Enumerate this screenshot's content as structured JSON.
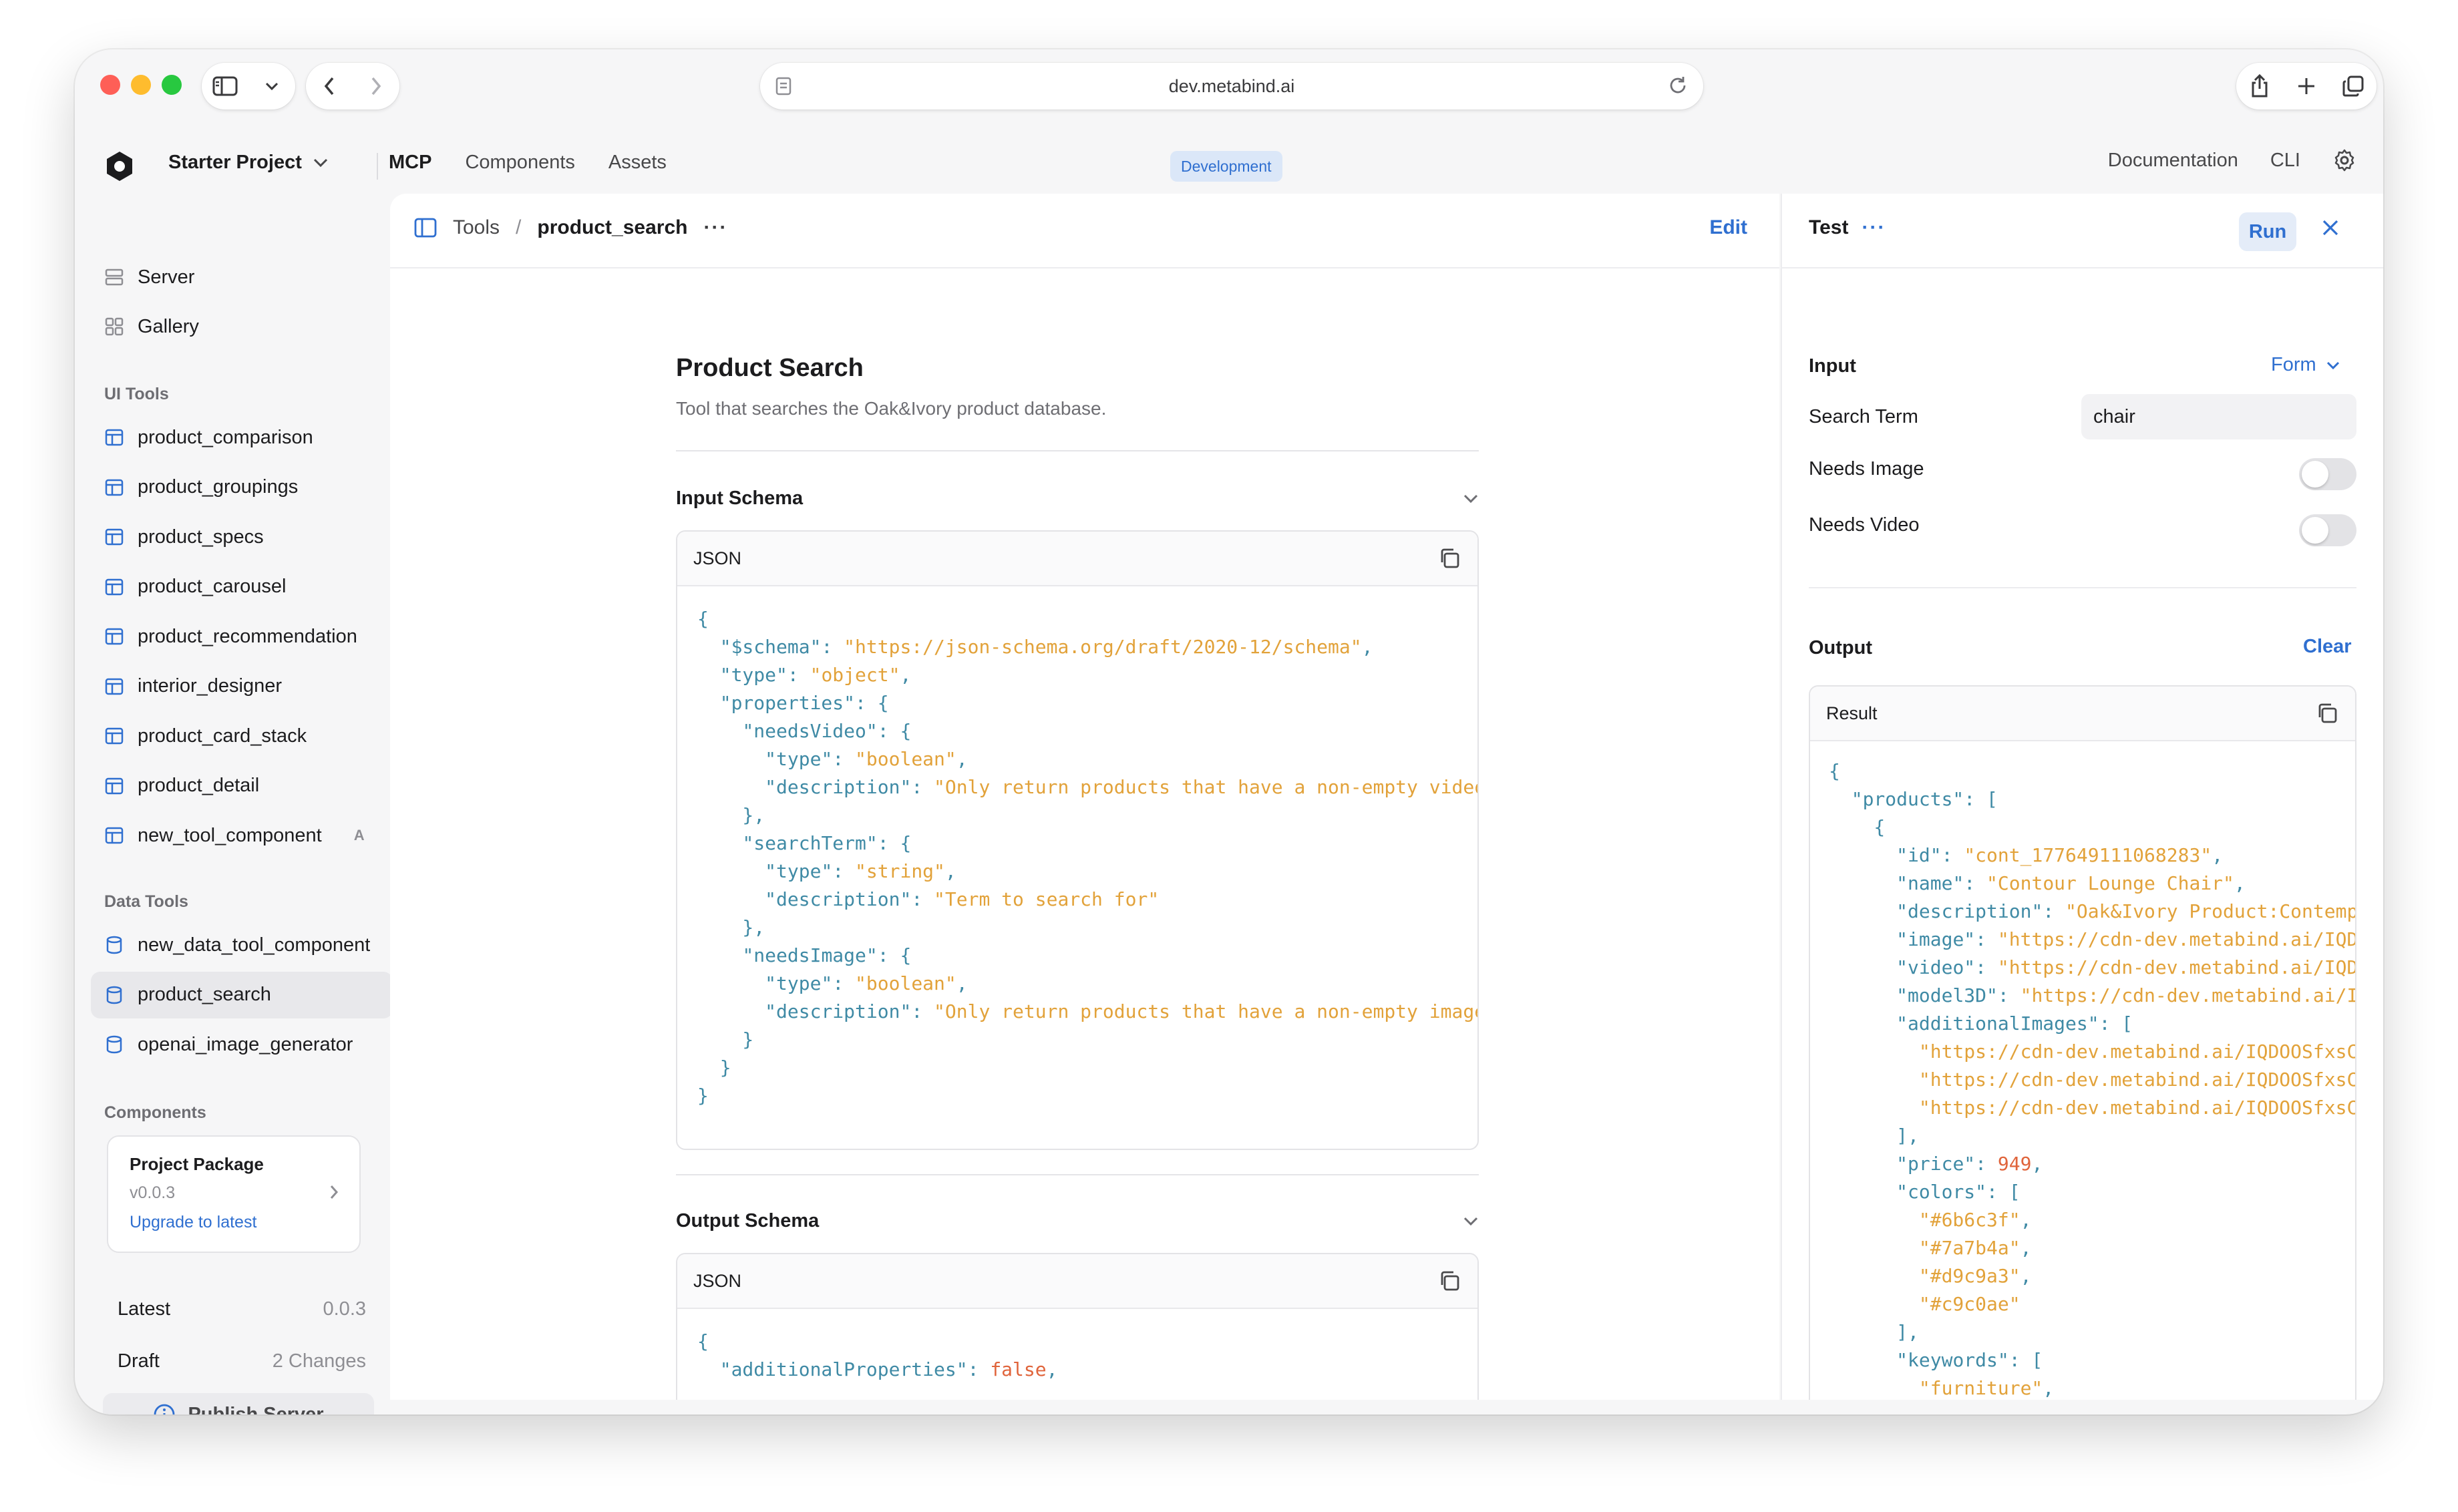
{
  "browser": {
    "url": "dev.metabind.ai"
  },
  "header": {
    "project_name": "Starter Project",
    "tabs": [
      {
        "label": "MCP",
        "active": true
      },
      {
        "label": "Components",
        "active": false
      },
      {
        "label": "Assets",
        "active": false
      }
    ],
    "env_badge": "Development",
    "links": [
      "Documentation",
      "CLI"
    ]
  },
  "sidebar": {
    "top_items": [
      {
        "label": "Server",
        "icon": "server-icon"
      },
      {
        "label": "Gallery",
        "icon": "grid-icon"
      }
    ],
    "ui_tools_title": "UI Tools",
    "ui_tools": [
      "product_comparison",
      "product_groupings",
      "product_specs",
      "product_carousel",
      "product_recommendation",
      "interior_designer",
      "product_card_stack",
      "product_detail",
      "new_tool_component"
    ],
    "ui_tool_badge": "A",
    "data_tools_title": "Data Tools",
    "data_tools": [
      "new_data_tool_component",
      "product_search",
      "openai_image_generator"
    ],
    "selected_tool": "product_search",
    "components_title": "Components",
    "package": {
      "title": "Project Package",
      "version": "v0.0.3",
      "upgrade_label": "Upgrade to latest"
    },
    "latest": {
      "label": "Latest",
      "value": "0.0.3"
    },
    "draft": {
      "label": "Draft",
      "value": "2 Changes"
    },
    "publish_label": "Publish Server"
  },
  "main": {
    "breadcrumb_root": "Tools",
    "breadcrumb_sep": "/",
    "breadcrumb_current": "product_search",
    "more_label": "···",
    "edit_label": "Edit",
    "title": "Product Search",
    "description": "Tool that searches the Oak&Ivory product database.",
    "input_schema": {
      "title": "Input Schema",
      "format_label": "JSON"
    },
    "output_schema": {
      "title": "Output Schema",
      "format_label": "JSON"
    }
  },
  "test": {
    "title": "Test",
    "more_label": "···",
    "run_label": "Run",
    "input_label": "Input",
    "mode_label": "Form",
    "fields": {
      "search_term": {
        "label": "Search Term",
        "value": "chair"
      },
      "needs_image": {
        "label": "Needs Image",
        "on": false
      },
      "needs_video": {
        "label": "Needs Video",
        "on": false
      }
    },
    "output_label": "Output",
    "clear_label": "Clear",
    "result_label": "Result"
  },
  "colors": {
    "accent": "#2f6fd0",
    "json_key": "#3f8aa5",
    "json_string": "#e2a23a",
    "json_number": "#e0643b"
  }
}
